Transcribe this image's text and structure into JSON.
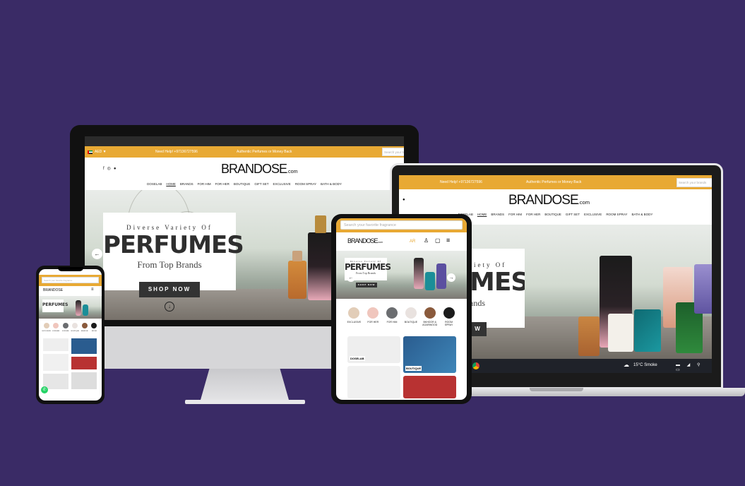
{
  "brand": {
    "name": "BRANDOSE",
    "suffix": ".com"
  },
  "topbar": {
    "currency": "AED ▼",
    "help": "Need Help! +97136727596",
    "promise": "Authentic Perfumes or Money Back",
    "search_placeholder": "Search your brands f"
  },
  "nav": {
    "items": [
      "DOSELAB",
      "HOME",
      "BRANDS",
      "FOR HIM",
      "FOR HER",
      "BOUTIQUE",
      "GIFT SET",
      "EXCLUSIVE",
      "ROOM SPRAY",
      "BATH & BODY"
    ]
  },
  "hero": {
    "kicker": "Diverse Variety Of",
    "headline": "PERFUMES",
    "subline": "From Top Brands",
    "cta": "SHOP NOW"
  },
  "laptop": {
    "help": "Need Help! +97136727596",
    "promise": "Authentic Perfumes or Money Back",
    "search_placeholder": "Search your brands",
    "hero_partial_kicker": "riety Of",
    "hero_partial_headline": "MES",
    "hero_partial_subline": "ands",
    "hero_partial_cta": "W",
    "taskbar_weather": "15°C Smoke"
  },
  "tablet": {
    "search_placeholder": "Search your favorite fragrance",
    "lang": "AR",
    "categories": [
      "EXCLUSIVE",
      "FOR HER",
      "FOR HIM",
      "BOUTIQUE",
      "BKHOOR & AGARWOOD",
      "ROOM SPRAY"
    ],
    "tile_labels": [
      "DOSELAB",
      "BOUTIQUE"
    ]
  },
  "phone": {
    "search_placeholder": "Search your favorite fragrance",
    "categories": [
      "EXCLUSIVE",
      "FOR HER",
      "FOR HIM",
      "BOUTIQUE",
      "BKHOOR",
      "ROOM"
    ]
  },
  "colors": {
    "background": "#3a2b66",
    "accent": "#e8a934",
    "dark": "#333333"
  }
}
